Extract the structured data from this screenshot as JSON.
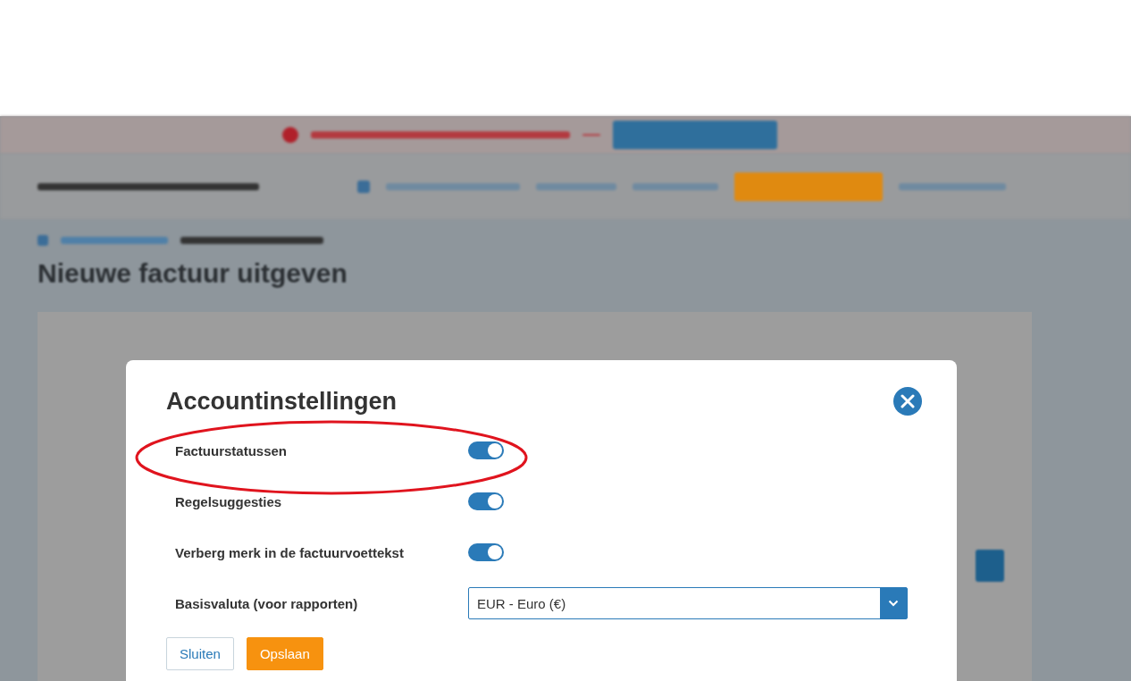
{
  "page": {
    "heading": "Nieuwe factuur uitgeven"
  },
  "modal": {
    "title": "Accountinstellingen",
    "settings": [
      {
        "kind": "toggle",
        "label": "Factuurstatussen",
        "on": true
      },
      {
        "kind": "toggle",
        "label": "Regelsuggesties",
        "on": true
      },
      {
        "kind": "toggle",
        "label": "Verberg merk in de factuurvoettekst",
        "on": true
      },
      {
        "kind": "select",
        "label": "Basisvaluta (voor rapporten)",
        "value": "EUR - Euro (€)"
      }
    ],
    "buttons": [
      {
        "kind": "secondary",
        "label": "Sluiten"
      },
      {
        "kind": "primary",
        "label": "Opslaan"
      }
    ]
  }
}
